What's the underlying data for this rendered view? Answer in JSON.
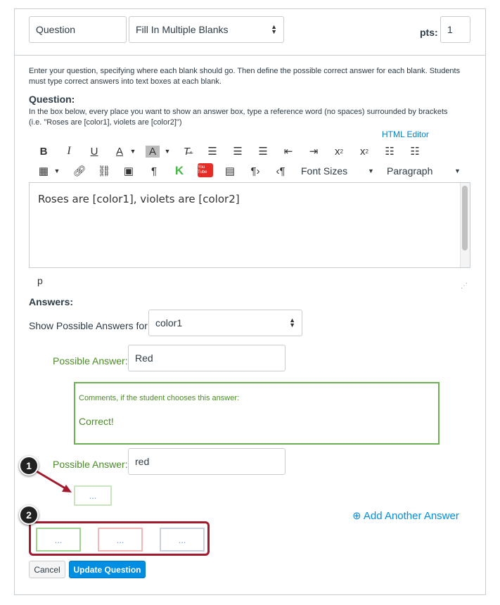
{
  "header": {
    "title_value": "Question",
    "type_value": "Fill In Multiple Blanks",
    "pts_label": "pts:",
    "pts_value": "1"
  },
  "instructions": {
    "line1": "Enter your question, specifying where each blank should go. Then define the possible correct answer for each blank. Students",
    "line2": "must type correct answers into text boxes at each blank.",
    "question_label": "Question:",
    "hint1": "In the box below, every place you want to show an answer box, type a reference word (no spaces) surrounded by brackets",
    "hint2": "(i.e. \"Roses are [color1], violets are [color2]\")",
    "html_editor": "HTML Editor"
  },
  "toolbar": {
    "icons": [
      "bold-icon",
      "italic-icon",
      "underline-icon",
      "text-color-icon",
      "background-color-icon",
      "clear-formatting-icon",
      "align-left-icon",
      "align-center-icon",
      "align-right-icon",
      "outdent-icon",
      "indent-icon",
      "superscript-icon",
      "subscript-icon",
      "bullet-list-icon",
      "numbered-list-icon",
      "table-icon",
      "link-icon",
      "unlink-icon",
      "image-icon",
      "paragraph-mark-icon",
      "kaltura-icon",
      "youtube-icon",
      "media-icon",
      "ltr-icon",
      "rtl-icon"
    ],
    "font_sizes": "Font Sizes",
    "paragraph": "Paragraph",
    "youtube_text": "You Tube"
  },
  "editor": {
    "content": "Roses are [color1], violets are [color2]",
    "path": "p"
  },
  "answers": {
    "label": "Answers:",
    "show_label": "Show Possible Answers for",
    "show_value": "color1",
    "possible_label": "Possible Answer:",
    "answer1": "Red",
    "comment_label": "Comments, if the student chooses this answer:",
    "comment_text": "Correct!",
    "answer2": "red",
    "comment_placeholder": "...",
    "add_another": "Add Another Answer"
  },
  "callouts": {
    "one": "1",
    "two": "2"
  },
  "comment_icons": [
    "...",
    "...",
    "..."
  ],
  "buttons": {
    "cancel": "Cancel",
    "update": "Update Question"
  },
  "colors": {
    "accent": "#008ee2",
    "green": "#4b8b27",
    "red_annotation": "#a3192e"
  }
}
